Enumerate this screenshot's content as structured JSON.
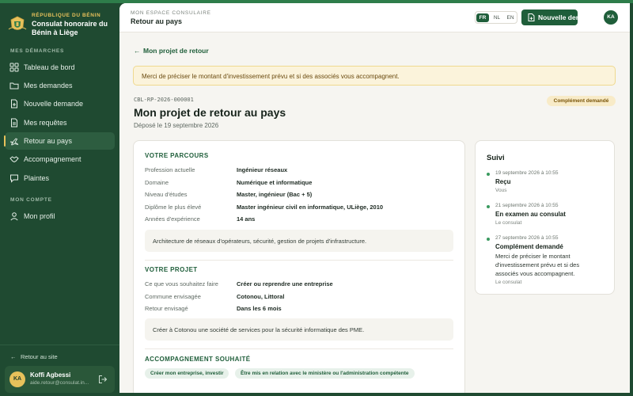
{
  "brand": {
    "sup": "RÉPUBLIQUE DU BÉNIN",
    "name": "Consulat honoraire du Bénin à Liège"
  },
  "sidebar": {
    "section1": "MES DÉMARCHES",
    "items": [
      {
        "label": "Tableau de bord",
        "icon": "dashboard-icon"
      },
      {
        "label": "Mes demandes",
        "icon": "folder-icon"
      },
      {
        "label": "Nouvelle demande",
        "icon": "file-plus-icon"
      },
      {
        "label": "Mes requêtes",
        "icon": "document-icon"
      },
      {
        "label": "Retour au pays",
        "icon": "plane-icon",
        "active": true
      },
      {
        "label": "Accompagnement",
        "icon": "handshake-icon"
      },
      {
        "label": "Plaintes",
        "icon": "message-icon"
      }
    ],
    "section2": "MON COMPTE",
    "account_items": [
      {
        "label": "Mon profil",
        "icon": "user-icon"
      }
    ],
    "back_site": "Retour au site",
    "user": {
      "initials": "KA",
      "name": "Koffi Agbessi",
      "email": "aide.retour@consulat.in..."
    }
  },
  "header": {
    "sup": "MON ESPACE CONSULAIRE",
    "title": "Retour au pays",
    "languages": [
      "FR",
      "NL",
      "EN"
    ],
    "active_language": "FR",
    "new_request": "Nouvelle demande",
    "avatar": "KA"
  },
  "content": {
    "back_link": "Mon projet de retour",
    "alert": "Merci de préciser le montant d'investissement prévu et si des associés vous accompagnent.",
    "reference": "CBL-RP-2026-000001",
    "status": "Complément demandé",
    "title": "Mon projet de retour au pays",
    "deposited": "Déposé le 19 septembre 2026"
  },
  "parcours": {
    "heading": "VOTRE PARCOURS",
    "rows": [
      {
        "k": "Profession actuelle",
        "v": "Ingénieur réseaux"
      },
      {
        "k": "Domaine",
        "v": "Numérique et informatique"
      },
      {
        "k": "Niveau d'études",
        "v": "Master, ingénieur (Bac + 5)"
      },
      {
        "k": "Diplôme le plus élevé",
        "v": "Master ingénieur civil en informatique, ULiège, 2010"
      },
      {
        "k": "Années d'expérience",
        "v": "14 ans"
      }
    ],
    "note": "Architecture de réseaux d'opérateurs, sécurité, gestion de projets d'infrastructure."
  },
  "projet": {
    "heading": "VOTRE PROJET",
    "rows": [
      {
        "k": "Ce que vous souhaitez faire",
        "v": "Créer ou reprendre une entreprise"
      },
      {
        "k": "Commune envisagée",
        "v": "Cotonou, Littoral"
      },
      {
        "k": "Retour envisagé",
        "v": "Dans les 6 mois"
      }
    ],
    "note": "Créer à Cotonou une société de services pour la sécurité informatique des PME."
  },
  "accompagnement": {
    "heading": "ACCOMPAGNEMENT SOUHAITÉ",
    "chips": [
      "Créer mon entreprise, investir",
      "Être mis en relation avec le ministère ou l'administration compétente"
    ]
  },
  "suivi": {
    "title": "Suivi",
    "events": [
      {
        "date": "19 septembre 2026 à 10:55",
        "title": "Reçu",
        "desc": "",
        "by": "Vous"
      },
      {
        "date": "21 septembre 2026 à 10:55",
        "title": "En examen au consulat",
        "desc": "",
        "by": "Le consulat"
      },
      {
        "date": "27 septembre 2026 à 10:55",
        "title": "Complément demandé",
        "desc": "Merci de préciser le montant d'investissement prévu et si des associés vous accompagnent.",
        "by": "Le consulat"
      }
    ]
  },
  "colors": {
    "sidebar_bg": "#1f4a31",
    "accent_green": "#1f5e3a",
    "gold": "#e7c15b",
    "alert_bg": "#fbf3db"
  }
}
